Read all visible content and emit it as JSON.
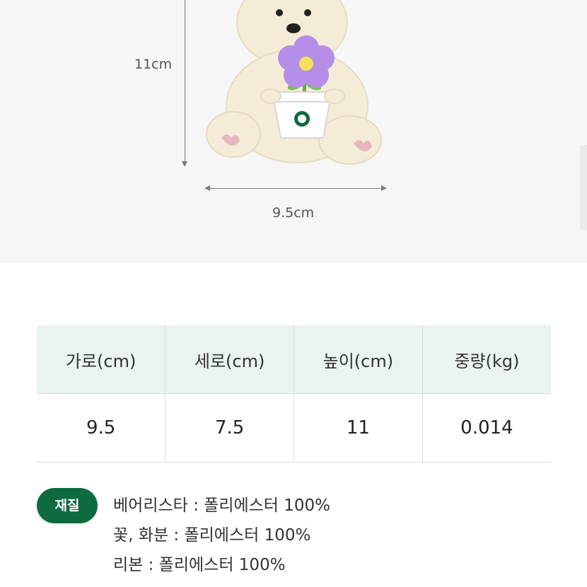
{
  "product_image": {
    "height_label": "11cm",
    "width_label": "9.5cm",
    "colors": {
      "background": "#f6f6f6",
      "bear_fur": "#f4ecd6",
      "flower_petal": "#b48ee8",
      "flower_center": "#f2e05a",
      "pot": "#ffffff",
      "pot_emblem": "#0e6b3f"
    }
  },
  "spec_table": {
    "headers": [
      "가로(cm)",
      "세로(cm)",
      "높이(cm)",
      "중량(kg)"
    ],
    "values": [
      "9.5",
      "7.5",
      "11",
      "0.014"
    ],
    "colors": {
      "header_bg": "#e9f3ef",
      "border": "#dcdcdc"
    }
  },
  "material": {
    "badge_label": "재질",
    "badge_color": "#0e6b3f",
    "items": [
      "베어리스타 : 폴리에스터 100%",
      "꽃, 화분 : 폴리에스터 100%",
      "리본 : 폴리에스터 100%"
    ]
  }
}
